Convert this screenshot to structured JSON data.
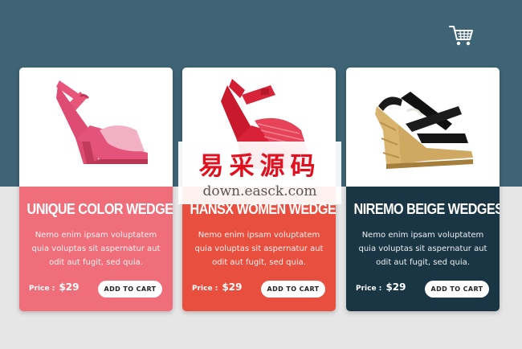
{
  "colors": {
    "top_band": "#3e6475",
    "page_background": "#e6e6e6",
    "card_1_accent": "#ef6e79",
    "card_2_accent": "#e94f3e",
    "card_3_accent": "#1a3644"
  },
  "header": {
    "cart_icon": "shopping-cart-icon"
  },
  "products": [
    {
      "title": "UNIQUE COLOR WEDGES",
      "description": "Nemo enim ipsam voluptatem quia voluptas sit aspernatur aut odit aut fugit, sed quia.",
      "price_label": "Price :",
      "price": "$29",
      "button_label": "ADD TO CART",
      "image_icon": "pink-wedge-sandal-image"
    },
    {
      "title": "HANSX WOMEN WEDGES",
      "description": "Nemo enim ipsam voluptatem quia voluptas sit aspernatur aut odit aut fugit, sed quia.",
      "price_label": "Price :",
      "price": "$29",
      "button_label": "ADD TO CART",
      "image_icon": "red-wedge-sandal-image"
    },
    {
      "title": "NIREMO BEIGE WEDGES",
      "description": "Nemo enim ipsam voluptatem quia voluptas sit aspernatur aut odit aut fugit, sed quia.",
      "price_label": "Price :",
      "price": "$29",
      "button_label": "ADD TO CART",
      "image_icon": "black-beige-wedge-sandal-image"
    }
  ],
  "watermark": {
    "chinese": "易采源码",
    "url": "down.easck.com"
  }
}
